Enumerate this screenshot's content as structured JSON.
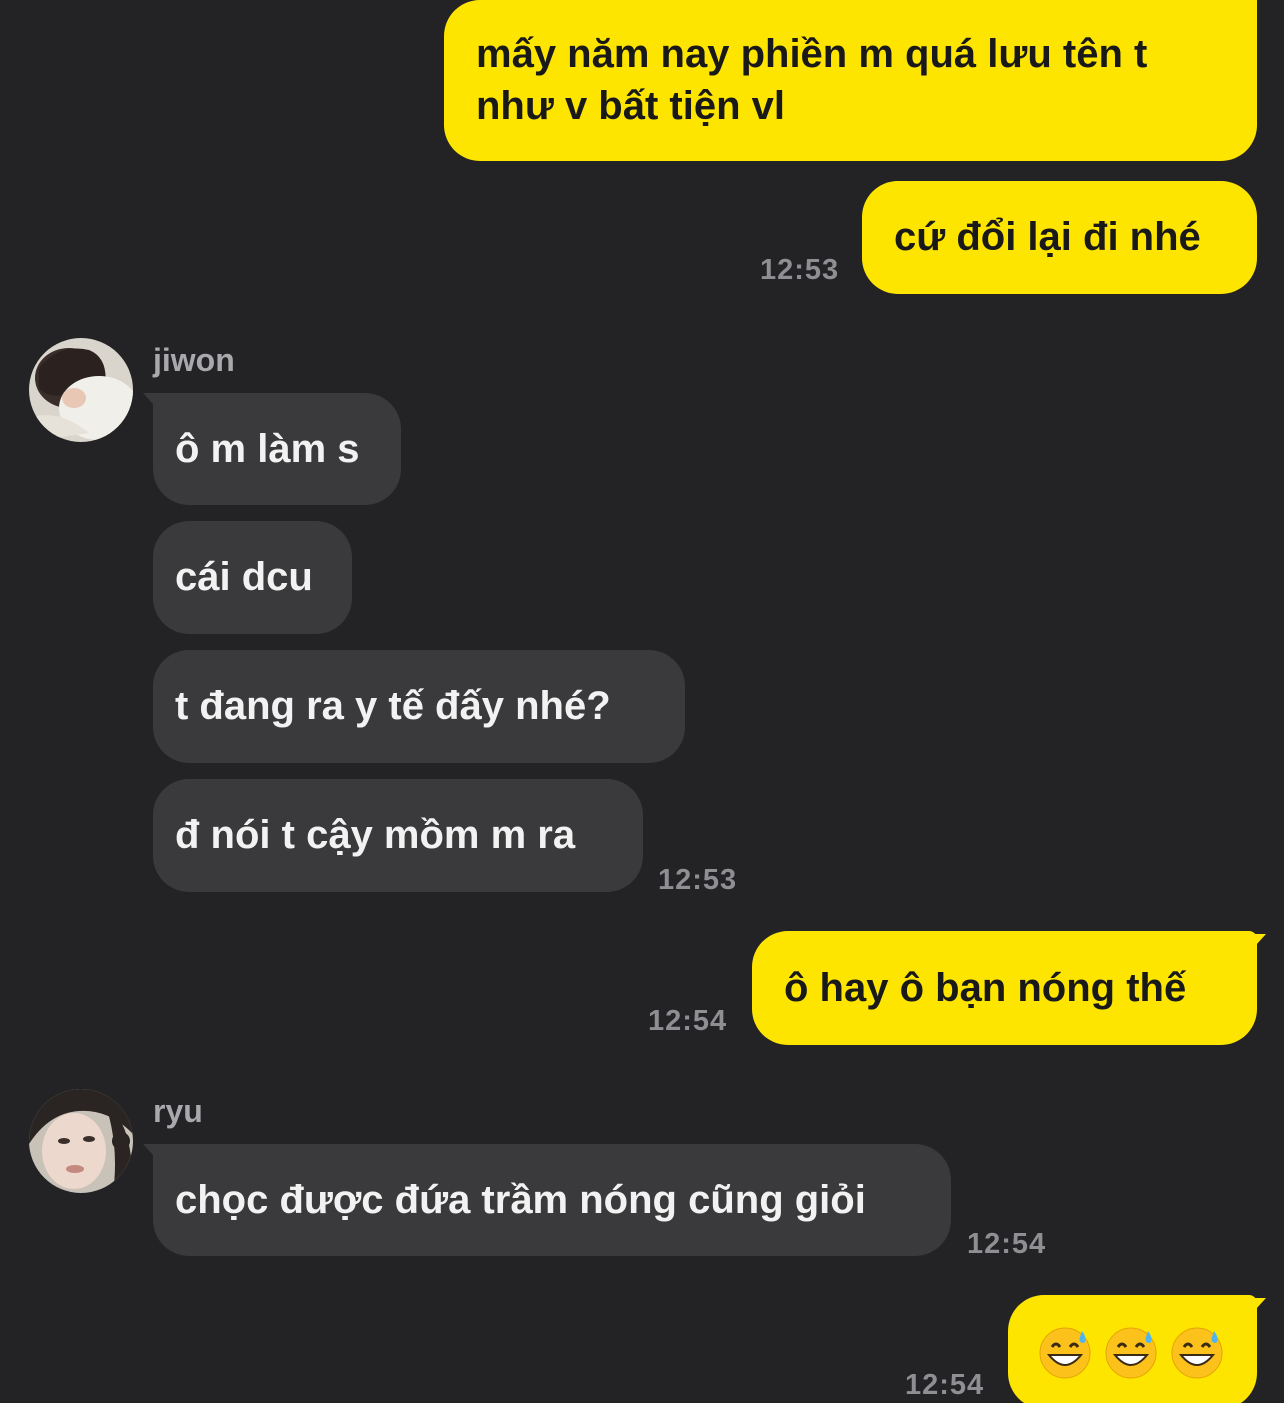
{
  "messages": {
    "m1": {
      "text_line1": "mấy năm nay phiền m quá lưu tên t",
      "text_line2": "như v bất tiện vl"
    },
    "m2": {
      "text": "cứ đổi lại đi nhé",
      "time": "12:53"
    },
    "jiwon": {
      "name": "jiwon",
      "msg1": "ô m làm s",
      "msg2": "cái dcu",
      "msg3": "t đang ra y tế đấy nhé?",
      "msg4": "đ nói t cậy mồm m ra",
      "time": "12:53"
    },
    "m3": {
      "text": "ô hay ô bạn nóng thế",
      "time": "12:54"
    },
    "ryu": {
      "name": "ryu",
      "msg1": "chọc được đứa trầm nóng cũng giỏi",
      "time": "12:54"
    },
    "m4": {
      "emoji": [
        "grinning-sweat-emoji",
        "grinning-sweat-emoji",
        "grinning-sweat-emoji"
      ],
      "time": "12:54"
    }
  },
  "colors": {
    "background": "#232325",
    "outgoing_bubble": "#FEE500",
    "incoming_bubble": "#3A3A3C",
    "timestamp": "#8E8E93"
  }
}
